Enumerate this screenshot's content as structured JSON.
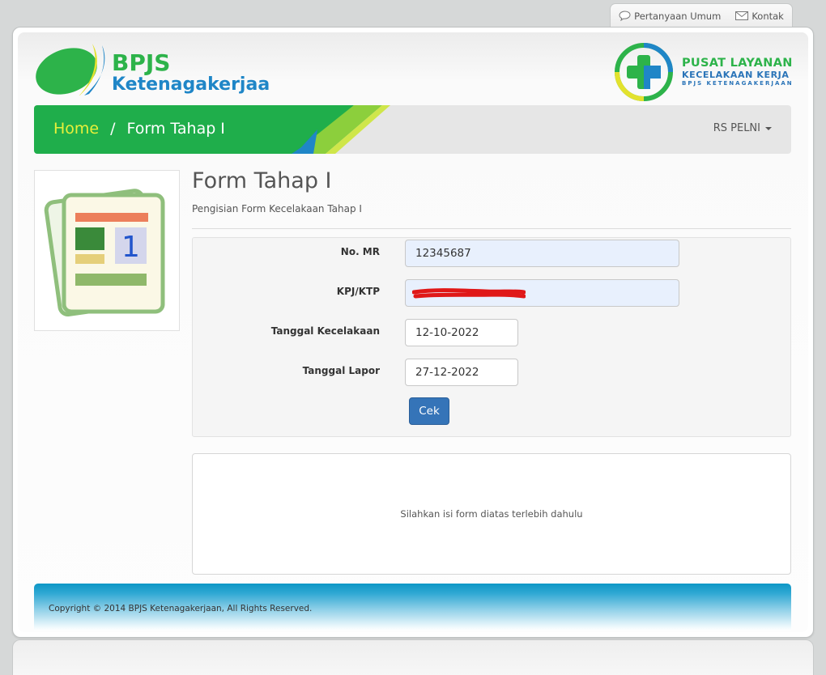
{
  "toplinks": {
    "faq_label": "Pertanyaan Umum",
    "contact_label": "Kontak"
  },
  "brand": {
    "name_top": "BPJS",
    "name_bottom": "Ketenagakerjaan",
    "partner_line1": "PUSAT LAYANAN",
    "partner_line2": "KECELAKAAN KERJA",
    "partner_line3": "BPJS KETENAGAKERJAAN"
  },
  "breadcrumb": {
    "home": "Home",
    "separator": "/",
    "current": "Form Tahap I"
  },
  "user_menu": {
    "label": "RS PELNI"
  },
  "thumbnail": {
    "number": "1"
  },
  "page": {
    "title": "Form Tahap I",
    "subtitle": "Pengisian Form Kecelakaan Tahap I"
  },
  "form": {
    "no_mr": {
      "label": "No. MR",
      "value": "12345687"
    },
    "kpj_ktp": {
      "label": "KPJ/KTP",
      "value": ""
    },
    "tanggal_kecelakaan": {
      "label": "Tanggal Kecelakaan",
      "value": "12-10-2022"
    },
    "tanggal_lapor": {
      "label": "Tanggal Lapor",
      "value": "27-12-2022"
    },
    "submit_label": "Cek"
  },
  "result": {
    "message": "Silahkan isi form diatas terlebih dahulu"
  },
  "footer": {
    "copyright": "Copyright © 2014 BPJS Ketenagakerjaan, All Rights Reserved."
  },
  "colors": {
    "brand_green": "#2db34a",
    "brand_blue": "#2a74b8",
    "button_blue": "#3574b8",
    "crumb_home": "#e8f03a"
  }
}
